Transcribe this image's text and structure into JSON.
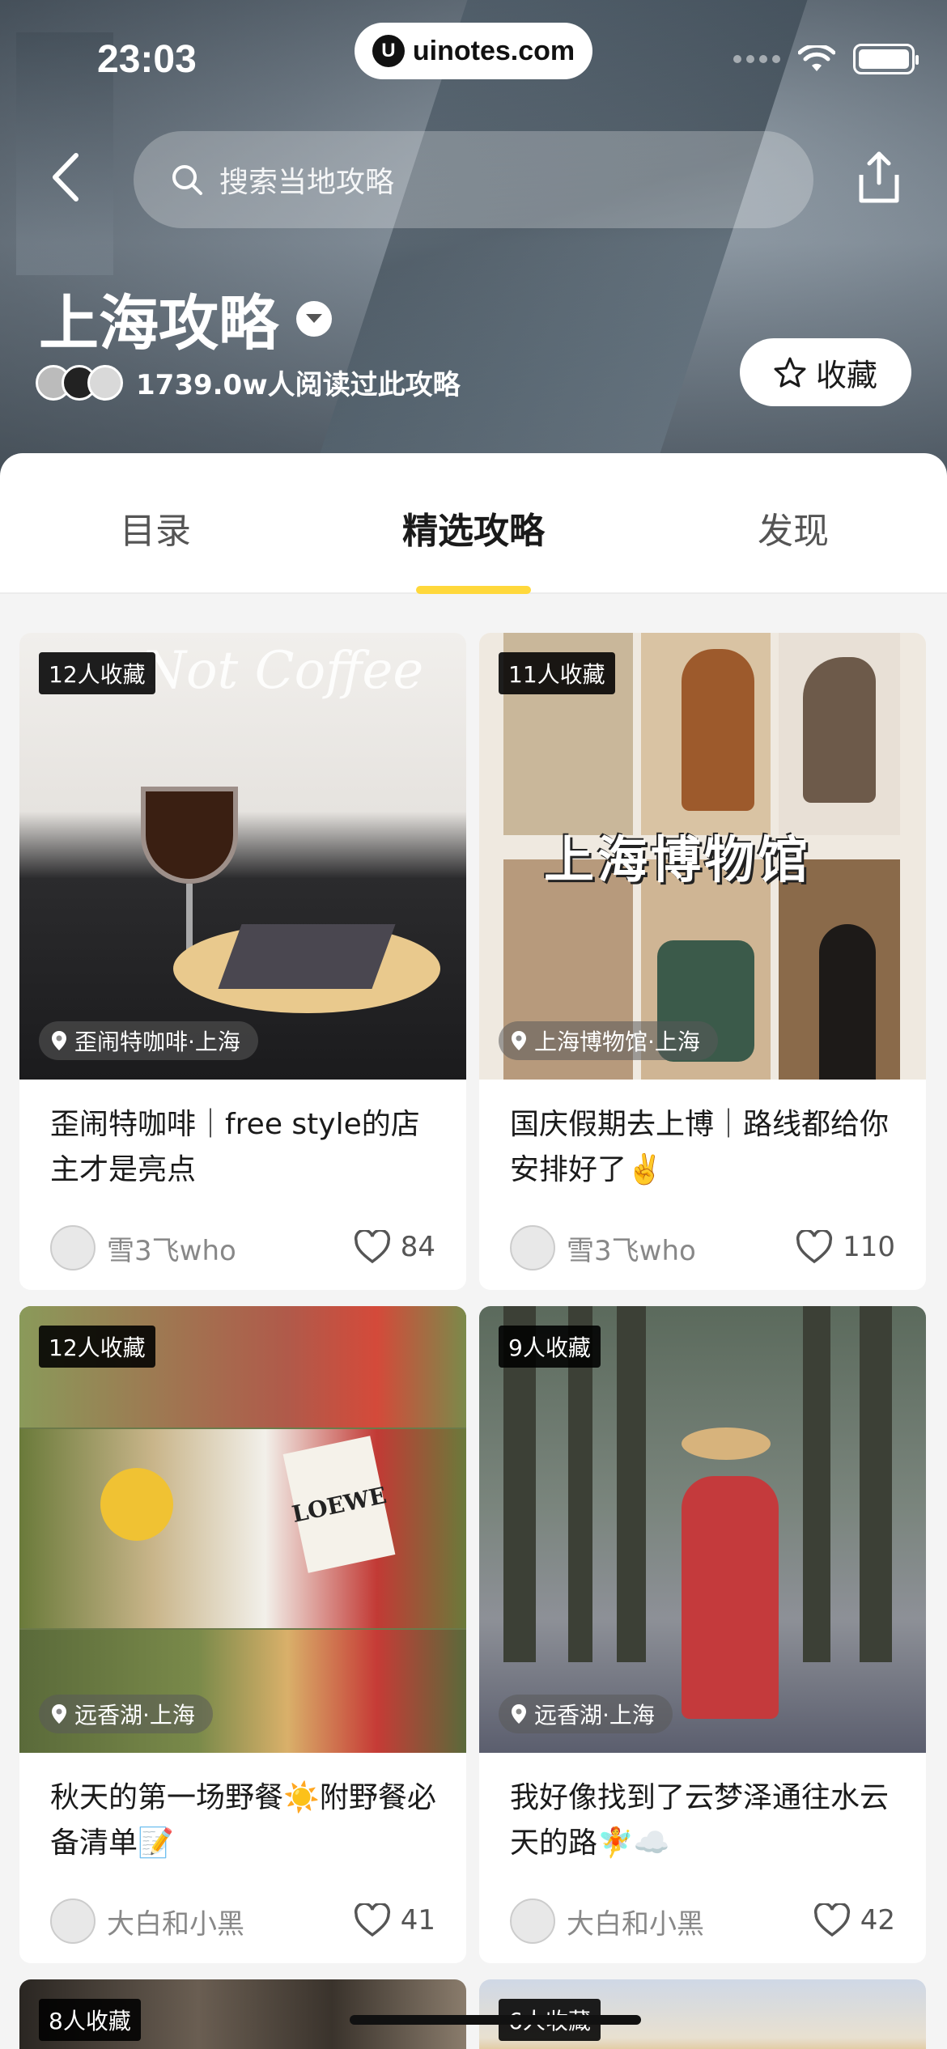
{
  "status": {
    "time": "23:03",
    "url": "uinotes.com"
  },
  "header": {
    "search_placeholder": "搜索当地攻略",
    "city_title": "上海攻略",
    "readers_text": "1739.0w人阅读过此攻略",
    "favorite_label": "收藏"
  },
  "tabs": [
    {
      "label": "目录",
      "active": false
    },
    {
      "label": "精选攻略",
      "active": true
    },
    {
      "label": "发现",
      "active": false
    }
  ],
  "colors": {
    "accent": "#ffd83b",
    "badge_bg": "#000000"
  },
  "cards": [
    {
      "badge": "12人收藏",
      "location": "歪闹特咖啡·上海",
      "title": "歪闹特咖啡｜free style的店主才是亮点",
      "author": "雪3飞who",
      "likes": "84",
      "image_text": "Not Coffee"
    },
    {
      "badge": "11人收藏",
      "location": "上海博物馆·上海",
      "title": "国庆假期去上博｜路线都给你安排好了✌️",
      "author": "雪3飞who",
      "likes": "110",
      "image_text": "上海博物馆"
    },
    {
      "badge": "12人收藏",
      "location": "远香湖·上海",
      "title": "秋天的第一场野餐☀️附野餐必备清单📝",
      "author": "大白和小黑",
      "likes": "41",
      "image_text": "LOEWE"
    },
    {
      "badge": "9人收藏",
      "location": "远香湖·上海",
      "title": "我好像找到了云梦泽通往水云天的路🧚☁️",
      "author": "大白和小黑",
      "likes": "42"
    },
    {
      "badge": "8人收藏"
    },
    {
      "badge": "6人收藏"
    }
  ]
}
